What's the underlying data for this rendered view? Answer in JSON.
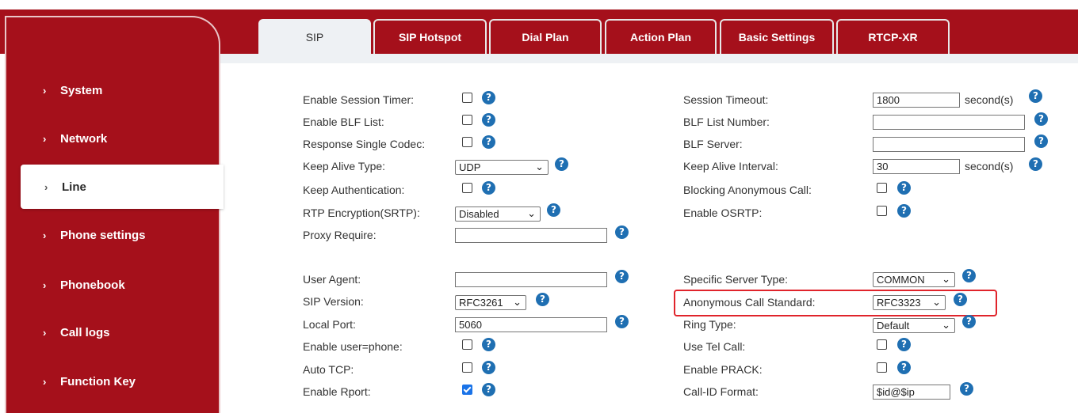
{
  "sidebar": {
    "items": [
      {
        "label": "System"
      },
      {
        "label": "Network"
      },
      {
        "label": "Line"
      },
      {
        "label": "Phone settings"
      },
      {
        "label": "Phonebook"
      },
      {
        "label": "Call logs"
      },
      {
        "label": "Function Key"
      }
    ],
    "active": "Line"
  },
  "tabs": [
    "SIP",
    "SIP Hotspot",
    "Dial Plan",
    "Action Plan",
    "Basic Settings",
    "RTCP-XR"
  ],
  "active_tab": "SIP",
  "left": {
    "enable_session_timer": "Enable Session Timer:",
    "enable_blf_list": "Enable BLF List:",
    "response_single_codec": "Response Single Codec:",
    "keep_alive_type": "Keep Alive Type:",
    "keep_alive_type_value": "UDP",
    "keep_authentication": "Keep Authentication:",
    "rtp_encryption": "RTP Encryption(SRTP):",
    "rtp_encryption_value": "Disabled",
    "proxy_require": "Proxy Require:",
    "proxy_require_value": "",
    "user_agent": "User Agent:",
    "user_agent_value": "",
    "sip_version": "SIP Version:",
    "sip_version_value": "RFC3261",
    "local_port": "Local Port:",
    "local_port_value": "5060",
    "enable_user_phone": "Enable user=phone:",
    "auto_tcp": "Auto TCP:",
    "enable_rport": "Enable Rport:"
  },
  "right": {
    "session_timeout": "Session Timeout:",
    "session_timeout_value": "1800",
    "blf_list_number": "BLF List Number:",
    "blf_list_number_value": "",
    "blf_server": "BLF Server:",
    "blf_server_value": "",
    "keep_alive_interval": "Keep Alive Interval:",
    "keep_alive_interval_value": "30",
    "blocking_anonymous_call": "Blocking Anonymous Call:",
    "enable_osrtp": "Enable OSRTP:",
    "specific_server_type": "Specific Server Type:",
    "specific_server_type_value": "COMMON",
    "anonymous_call_standard": "Anonymous Call Standard:",
    "anonymous_call_standard_value": "RFC3323",
    "ring_type": "Ring Type:",
    "ring_type_value": "Default",
    "use_tel_call": "Use Tel Call:",
    "enable_prack": "Enable PRACK:",
    "call_id_format": "Call-ID Format:",
    "call_id_format_value": "$id@$ip"
  },
  "unit_seconds": "second(s)",
  "help_glyph": "?",
  "chevron_glyph": "›",
  "select_arrow_glyph": "⌄",
  "checkboxes": {
    "enable_session_timer": false,
    "enable_blf_list": false,
    "response_single_codec": false,
    "keep_authentication": false,
    "enable_user_phone": false,
    "auto_tcp": false,
    "enable_rport": true,
    "blocking_anonymous_call": false,
    "enable_osrtp": false,
    "use_tel_call": false,
    "enable_prack": false
  },
  "colors": {
    "brand_red": "#a5101b",
    "help_blue": "#1f6fb2",
    "highlight": "#e0242b",
    "check_blue": "#1a73e8"
  }
}
